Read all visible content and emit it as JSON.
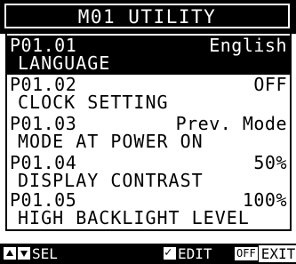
{
  "header": {
    "title": "M01 UTILITY"
  },
  "parameters": [
    {
      "code": "P01.01",
      "value": "English",
      "label": "LANGUAGE",
      "selected": true
    },
    {
      "code": "P01.02",
      "value": "OFF",
      "label": "CLOCK SETTING",
      "selected": false
    },
    {
      "code": "P01.03",
      "value": "Prev. Mode",
      "label": "MODE AT POWER ON",
      "selected": false
    },
    {
      "code": "P01.04",
      "value": "50%",
      "label": "DISPLAY CONTRAST",
      "selected": false
    },
    {
      "code": "P01.05",
      "value": "100%",
      "label": "HIGH BACKLIGHT LEVEL",
      "selected": false
    }
  ],
  "footer": {
    "select_label": "SEL",
    "edit_label": "EDIT",
    "exit_key": "OFF",
    "exit_label": "EXIT"
  },
  "colors": {
    "background": "#ffffff",
    "foreground": "#000000"
  },
  "icons": {
    "select": "up-down-arrows-icon",
    "edit": "checkmark-icon"
  }
}
